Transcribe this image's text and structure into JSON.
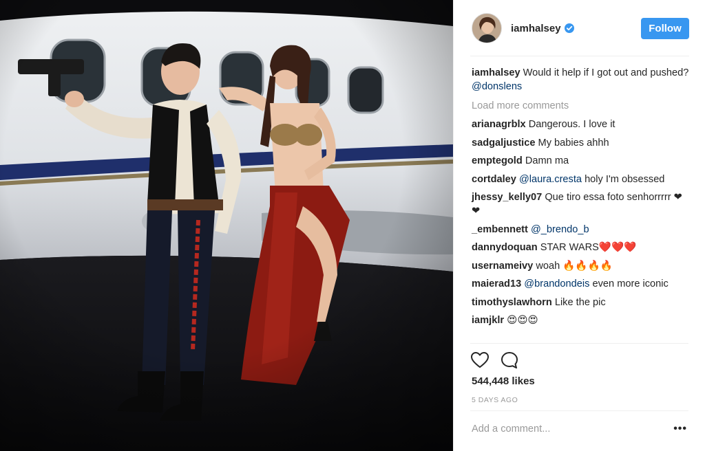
{
  "post": {
    "username": "iamhalsey",
    "verified": true,
    "follow_label": "Follow",
    "caption": {
      "user": "iamhalsey",
      "text": "Would it help if I got out and pushed? ",
      "mention": "@donslens"
    },
    "load_more": "Load more comments",
    "comments": [
      {
        "user": "arianagrblx",
        "pre": "Dangerous. I love it",
        "mention": "",
        "post": ""
      },
      {
        "user": "sadgaljustice",
        "pre": "My babies ahhh",
        "mention": "",
        "post": ""
      },
      {
        "user": "emptegold",
        "pre": "Damn ma",
        "mention": "",
        "post": ""
      },
      {
        "user": "cortdaley",
        "pre": "",
        "mention": "@laura.cresta",
        "post": " holy I'm obsessed"
      },
      {
        "user": "jhessy_kelly07",
        "pre": "Que tiro essa foto senhorrrrr ❤❤",
        "mention": "",
        "post": ""
      },
      {
        "user": "_embennett",
        "pre": "",
        "mention": "@_brendo_b",
        "post": ""
      },
      {
        "user": "dannydoquan",
        "pre": "STAR WARS❤️❤️❤️",
        "mention": "",
        "post": ""
      },
      {
        "user": "usernameivy",
        "pre": "woah 🔥🔥🔥🔥",
        "mention": "",
        "post": ""
      },
      {
        "user": "maierad13",
        "pre": "",
        "mention": "@brandondeis",
        "post": " even more iconic"
      },
      {
        "user": "timothyslawhorn",
        "pre": "Like the pic",
        "mention": "",
        "post": ""
      },
      {
        "user": "iamjklr",
        "pre": "😍😍😍",
        "mention": "",
        "post": ""
      }
    ],
    "likes": "544,448 likes",
    "date": "5 DAYS AGO",
    "add_comment_placeholder": "Add a comment...",
    "more_label": "•••"
  },
  "icons": {
    "like": "heart-icon",
    "comment": "comment-bubble-icon",
    "verified": "verified-badge-icon",
    "more": "more-options-icon"
  },
  "colors": {
    "follow_button": "#3897f0",
    "mention": "#003569",
    "muted_text": "#999999",
    "verified_badge": "#3897f0"
  }
}
